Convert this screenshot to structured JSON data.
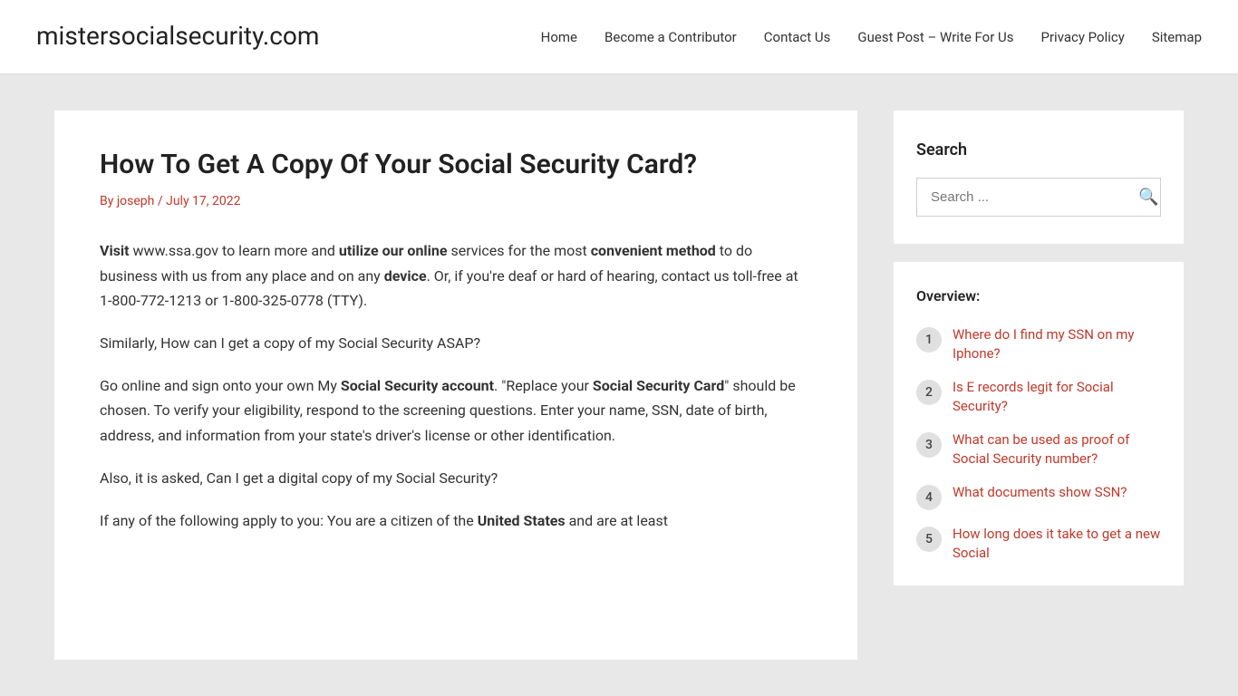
{
  "header": {
    "logo": "mistersocialsecurity.com",
    "nav": [
      {
        "label": "Home",
        "href": "#"
      },
      {
        "label": "Become a Contributor",
        "href": "#"
      },
      {
        "label": "Contact Us",
        "href": "#"
      },
      {
        "label": "Guest Post – Write For Us",
        "href": "#"
      },
      {
        "label": "Privacy Policy",
        "href": "#"
      },
      {
        "label": "Sitemap",
        "href": "#"
      }
    ]
  },
  "article": {
    "title": "How To Get A Copy Of Your Social Security Card?",
    "meta": "By joseph / July 17, 2022",
    "paragraphs": [
      {
        "id": "p1",
        "html": "<strong>Visit</strong> www.ssa.gov to learn more and <strong>utilize our online</strong> services for the most <strong>convenient method</strong> to do business with us from any place and on any <strong>device</strong>. Or, if you're deaf or hard of hearing, contact us toll-free at 1-800-772-1213 or 1-800-325-0778 (TTY)."
      },
      {
        "id": "p2",
        "html": "Similarly, How can I get a copy of my Social Security ASAP?"
      },
      {
        "id": "p3",
        "html": "Go online and sign onto your own My <strong>Social Security account</strong>. \"Replace your <strong>Social Security Card</strong>\" should be chosen. To verify your eligibility, respond to the screening questions. Enter your name, SSN, date of birth, address, and information from your state's driver's license or other identification."
      },
      {
        "id": "p4",
        "html": "Also, it is asked, Can I get a digital copy of my Social Security?"
      },
      {
        "id": "p5",
        "html": "If any of the following apply to you: You are a citizen of the <strong>United States</strong> and are at least"
      }
    ]
  },
  "sidebar": {
    "search": {
      "heading": "Search",
      "placeholder": "Search ..."
    },
    "overview": {
      "heading": "Overview:",
      "items": [
        {
          "number": "1",
          "label": "Where do I find my SSN on my Iphone?"
        },
        {
          "number": "2",
          "label": "Is E records legit for Social Security?"
        },
        {
          "number": "3",
          "label": "What can be used as proof of Social Security number?"
        },
        {
          "number": "4",
          "label": "What documents show SSN?"
        },
        {
          "number": "5",
          "label": "How long does it take to get a new Social"
        }
      ]
    }
  }
}
